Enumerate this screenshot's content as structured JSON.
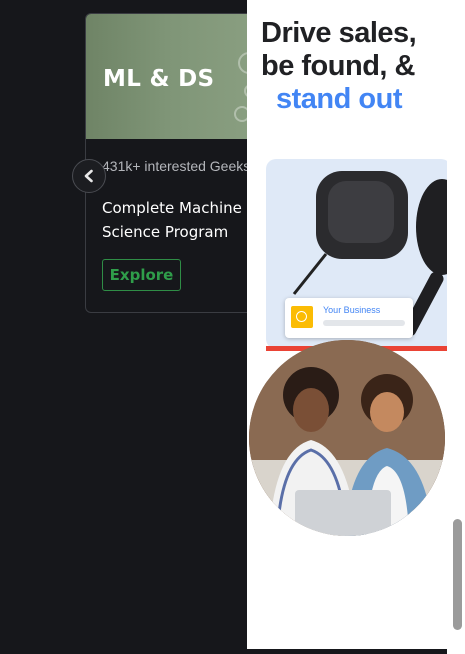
{
  "course_card": {
    "banner_title": "ML & DS",
    "interested": "431k+ interested Geeks",
    "title": "Complete Machine Learning & Data Science Program",
    "button_label": "Explore"
  },
  "carousel": {
    "prev_icon": "chevron-left-icon"
  },
  "ad": {
    "headline_line1": "Drive sales,",
    "headline_line2": "be found, &",
    "headline_line3": "stand out",
    "business_card_label": "Your Business",
    "headline_color": "#202124",
    "accent_color": "#4285f4"
  },
  "colors": {
    "page_bg": "#16171b",
    "accent_green": "#2f8d46",
    "banner_green": "#7f9577"
  }
}
